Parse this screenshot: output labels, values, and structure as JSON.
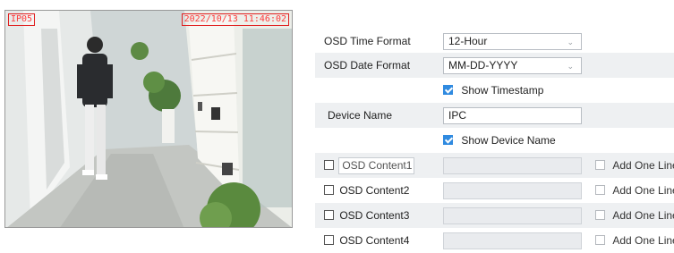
{
  "preview": {
    "osd_name": "IP05",
    "osd_time": "2022/10/13 11:46:02"
  },
  "settings": {
    "time_format": {
      "label": "OSD Time Format",
      "value": "12-Hour"
    },
    "date_format": {
      "label": "OSD Date Format",
      "value": "MM-DD-YYYY"
    },
    "show_timestamp": {
      "label": "Show Timestamp",
      "checked": true
    },
    "device_name": {
      "label": "Device Name",
      "value": "IPC"
    },
    "show_device_name": {
      "label": "Show Device Name",
      "checked": true
    },
    "osd_contents": [
      {
        "label": "OSD Content1",
        "value": "",
        "add_line": "Add One Line"
      },
      {
        "label": "OSD Content2",
        "value": "",
        "add_line": "Add One Line"
      },
      {
        "label": "OSD Content3",
        "value": "",
        "add_line": "Add One Line"
      },
      {
        "label": "OSD Content4",
        "value": "",
        "add_line": "Add One Line"
      }
    ]
  }
}
